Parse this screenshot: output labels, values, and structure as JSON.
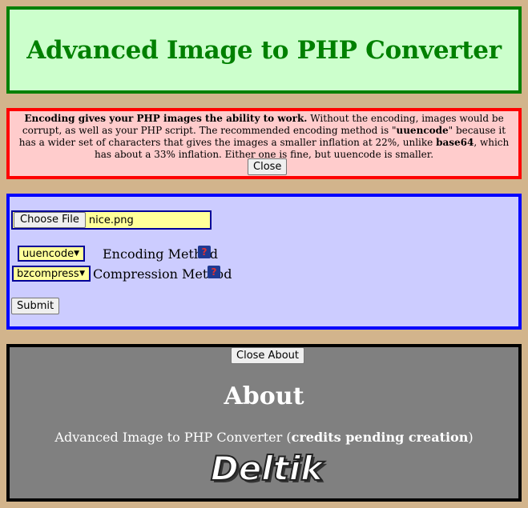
{
  "header": {
    "title": "Advanced Image to PHP Converter"
  },
  "notice": {
    "bold_intro": "Encoding gives your PHP images the ability to work.",
    "text_1": " Without the encoding, images would be corrupt, as well as your PHP script. The recommended encoding method is \"",
    "highlight_uuencode": "uuencode",
    "text_2": "\" because it has a wider set of characters that gives the images a smaller inflation at 22%, unlike ",
    "highlight_base64": "base64",
    "text_3": ", which has about a 33% inflation. Either one is fine, but uuencode is smaller.",
    "close_label": "Close"
  },
  "form": {
    "choose_file_label": "Choose File",
    "file_name": "nice.png",
    "encoding_value": "uuencode",
    "encoding_label": "Encoding Method",
    "compression_value": "bzcompress",
    "compression_label": "Compression Method",
    "submit_label": "Submit"
  },
  "about": {
    "close_label": "Close About",
    "heading": "About",
    "credits_prefix": "Advanced Image to PHP Converter (",
    "credits_bold": "credits pending creation",
    "credits_suffix": ")",
    "logo_text": "Deltik"
  },
  "colors": {
    "page_bg": "#d2b48c",
    "header_bg": "#ccffcc",
    "header_border": "#008000",
    "notice_bg": "#ffcccc",
    "notice_border": "#ff0000",
    "form_bg": "#ccccff",
    "form_border": "#0000ff",
    "about_bg": "#808080",
    "about_border": "#000000",
    "input_bg": "#ffff99"
  },
  "icons": {
    "help": "help-question-icon",
    "dropdown": "dropdown-arrow-icon"
  }
}
